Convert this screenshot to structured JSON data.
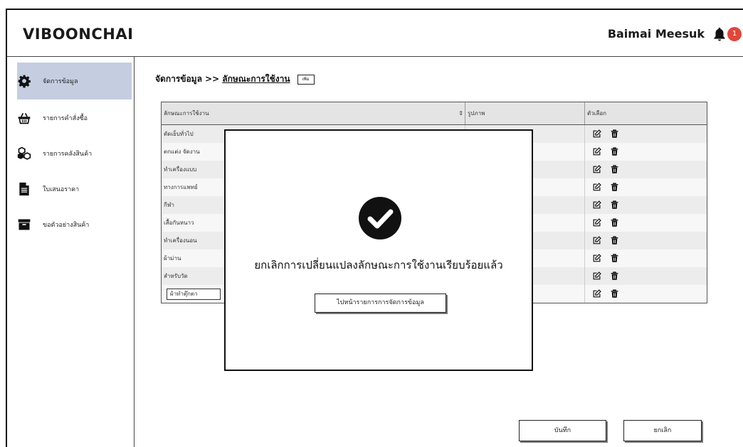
{
  "app": {
    "brand": "VIBOONCHAI"
  },
  "header": {
    "user_name": "Baimai Meesuk",
    "notification_count": "1",
    "notification_color": "#e0473a"
  },
  "sidebar": {
    "items": [
      {
        "label": "จัดการข้อมูล",
        "icon": "gear-icon",
        "active": true
      },
      {
        "label": "รายการคำสั่งซื้อ",
        "icon": "basket-icon"
      },
      {
        "label": "รายการคลังสินค้า",
        "icon": "boxes-icon"
      },
      {
        "label": "ใบเสนอราคา",
        "icon": "document-icon"
      },
      {
        "label": "ขอตัวอย่างสินค้า",
        "icon": "archive-icon"
      }
    ]
  },
  "breadcrumb": {
    "root": "จัดการข้อมูล >>",
    "current": "ลักษณะการใช้งาน",
    "add_label": "เพิ่ม"
  },
  "table": {
    "headers": {
      "name": "ลักษณะการใช้งาน",
      "image": "รูปภาพ",
      "options": "ตัวเลือก"
    },
    "rows": [
      "ตัดเย็บทั่วไป",
      "ตกแต่ง จัดงาน",
      "ทำเครื่องแบบ",
      "ทางการแพทย์",
      "กีฬา",
      "เสื้อกันหนาว",
      "ทำเครื่องนอน",
      "ผ้าม่าน",
      "สำหรับวัด"
    ],
    "edit_row_value": "ผ้าทำตุ๊กตา"
  },
  "buttons": {
    "save": "บันทึก",
    "cancel": "ยกเลิก"
  },
  "modal": {
    "message": "ยกเลิกการเปลี่ยนแปลงลักษณะการใช้งานเรียบร้อยแล้ว",
    "button": "ไปหน้ารายการการจัดการข้อมูล"
  },
  "colors": {
    "active_sidebar": "#c4cee0",
    "accent": "#111111"
  }
}
